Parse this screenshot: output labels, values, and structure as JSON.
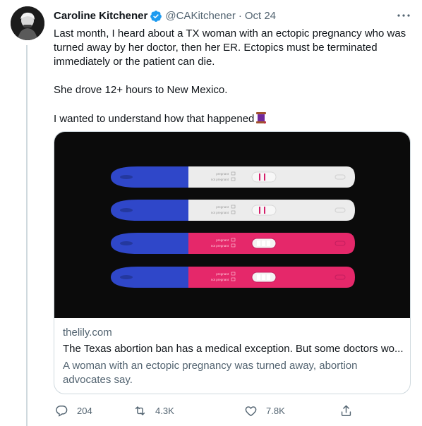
{
  "tweet": {
    "author_name": "Caroline Kitchener",
    "handle": "@CAKitchener",
    "separator": "·",
    "date": "Oct 24",
    "text_lines": [
      "Last month, I heard about a TX woman with an ectopic pregnancy who was turned away by her doctor, then her ER. Ectopics must be terminated immediately or the patient can die.",
      "She drove 12+ hours to New Mexico.",
      "I wanted to understand how that happened"
    ],
    "emoji": "thread-spool-icon"
  },
  "card": {
    "domain": "thelily.com",
    "title": "The Texas abortion ban has a medical exception. But some doctors wo...",
    "description": "A woman with an ectopic pregnancy was turned away, abortion advocates say.",
    "image": {
      "test_labels": [
        "pregnant",
        "not pregnant"
      ],
      "colors": {
        "blue": "#2f47c9",
        "white": "#ececec",
        "pink": "#e5286a",
        "line": "#d41f6a"
      }
    }
  },
  "actions": {
    "reply_count": "204",
    "retweet_count": "4.3K",
    "like_count": "7.8K"
  },
  "colors": {
    "text": "#0f1419",
    "secondary": "#536471",
    "verified": "#1d9bf0",
    "border": "#cfd9de"
  }
}
